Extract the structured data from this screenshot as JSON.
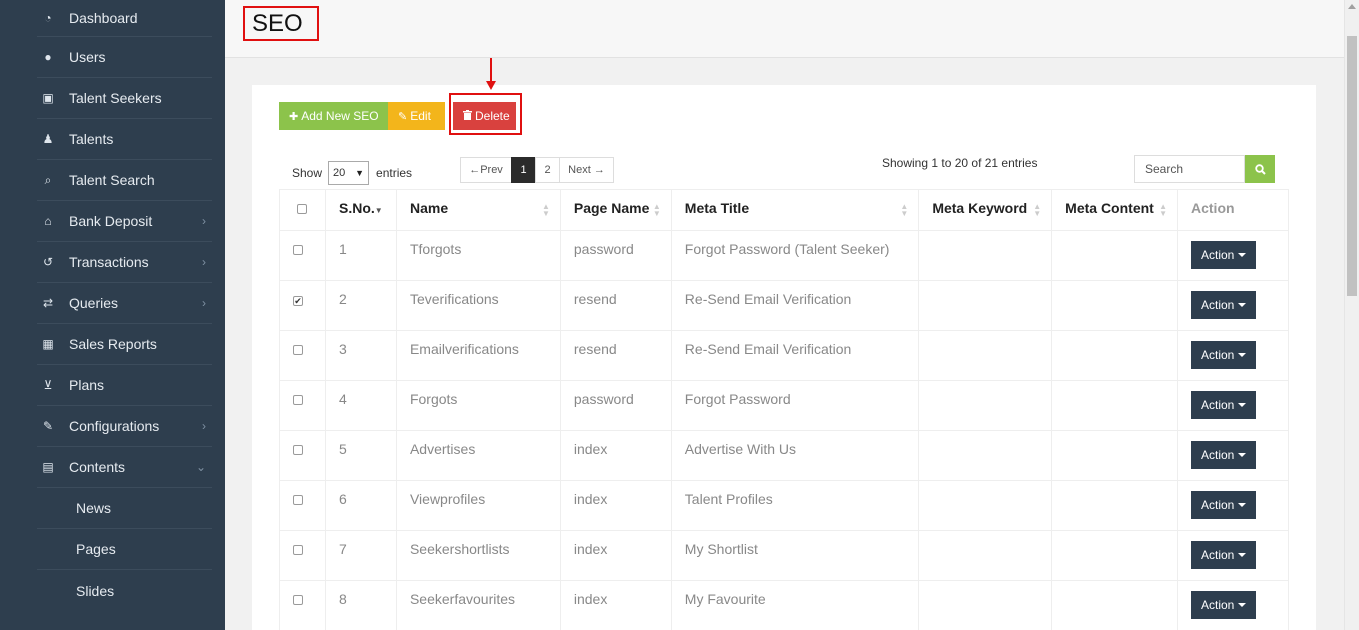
{
  "sidebar": {
    "items": [
      {
        "label": "Dashboard",
        "icon": "dashboard-icon",
        "glyph": "◔",
        "chevron": false
      },
      {
        "label": "Users",
        "icon": "user-icon",
        "glyph": "●",
        "chevron": false
      },
      {
        "label": "Talent Seekers",
        "icon": "suitcase-icon",
        "glyph": "▣",
        "chevron": false
      },
      {
        "label": "Talents",
        "icon": "users-icon",
        "glyph": "♟",
        "chevron": false
      },
      {
        "label": "Talent Search",
        "icon": "search-icon",
        "glyph": "⌕",
        "chevron": false
      },
      {
        "label": "Bank Deposit",
        "icon": "bank-icon",
        "glyph": "⌂",
        "chevron": true
      },
      {
        "label": "Transactions",
        "icon": "history-icon",
        "glyph": "↺",
        "chevron": true
      },
      {
        "label": "Queries",
        "icon": "exchange-icon",
        "glyph": "⇄",
        "chevron": true
      },
      {
        "label": "Sales Reports",
        "icon": "table-icon",
        "glyph": "▦",
        "chevron": false
      },
      {
        "label": "Plans",
        "icon": "cart-icon",
        "glyph": "⊻",
        "chevron": false
      },
      {
        "label": "Configurations",
        "icon": "wrench-icon",
        "glyph": "✎",
        "chevron": true
      },
      {
        "label": "Contents",
        "icon": "newspaper-icon",
        "glyph": "▤",
        "chevron": true,
        "expanded": true
      }
    ],
    "subitems": [
      "News",
      "Pages",
      "Slides"
    ],
    "chevron_right": "›",
    "chevron_down": "⌄"
  },
  "header": {
    "title": "SEO"
  },
  "toolbar": {
    "add_label": "Add New SEO",
    "add_glyph": "✚",
    "edit_label": "Edit",
    "edit_glyph": "✎",
    "delete_label": "Delete",
    "delete_glyph": "🗑"
  },
  "length": {
    "show_label": "Show",
    "value": "20",
    "entries_label": "entries"
  },
  "pagination": {
    "prev": "←Prev",
    "pages": [
      "1",
      "2"
    ],
    "active": "1",
    "next": "Next →"
  },
  "info": "Showing 1 to 20 of 21 entries",
  "search": {
    "placeholder": "Search"
  },
  "table": {
    "columns": [
      "S.No.",
      "Name",
      "Page Name",
      "Meta Title",
      "Meta Keyword",
      "Meta Content",
      "Action"
    ],
    "rows": [
      {
        "sno": "1",
        "name": "Tforgots",
        "page": "password",
        "title": "Forgot Password (Talent Seeker)",
        "keyword": "",
        "content": "",
        "checked": false
      },
      {
        "sno": "2",
        "name": "Teverifications",
        "page": "resend",
        "title": "Re-Send Email Verification",
        "keyword": "",
        "content": "",
        "checked": true
      },
      {
        "sno": "3",
        "name": "Emailverifications",
        "page": "resend",
        "title": "Re-Send Email Verification",
        "keyword": "",
        "content": "",
        "checked": false
      },
      {
        "sno": "4",
        "name": "Forgots",
        "page": "password",
        "title": "Forgot Password",
        "keyword": "",
        "content": "",
        "checked": false
      },
      {
        "sno": "5",
        "name": "Advertises",
        "page": "index",
        "title": "Advertise With Us",
        "keyword": "",
        "content": "",
        "checked": false
      },
      {
        "sno": "6",
        "name": "Viewprofiles",
        "page": "index",
        "title": "Talent Profiles",
        "keyword": "",
        "content": "",
        "checked": false
      },
      {
        "sno": "7",
        "name": "Seekershortlists",
        "page": "index",
        "title": "My Shortlist",
        "keyword": "",
        "content": "",
        "checked": false
      },
      {
        "sno": "8",
        "name": "Seekerfavourites",
        "page": "index",
        "title": "My Favourite",
        "keyword": "",
        "content": "",
        "checked": false
      }
    ],
    "action_label": "Action"
  },
  "colors": {
    "sidebar": "#2e3e4e",
    "add": "#8cc34b",
    "edit": "#f3b51b",
    "delete": "#d9413e",
    "highlight": "#e01010"
  }
}
